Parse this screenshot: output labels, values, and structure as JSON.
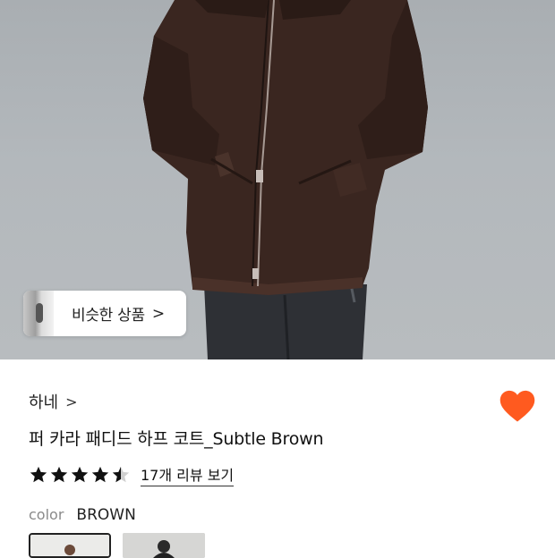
{
  "colors": {
    "accent": "#ff5a1f",
    "text": "#111111",
    "muted": "#8a8a8a"
  },
  "hero": {
    "image": "brown-padded-half-coat-photo",
    "similar_label": "비슷한 상품",
    "similar_chevron": ">"
  },
  "product": {
    "brand": "하네",
    "brand_chevron": ">",
    "title": "퍼 카라 패디드 하프 코트_Subtle Brown",
    "wishlisted": true,
    "rating": 4.5,
    "rating_max": 5,
    "reviews_link": "17개 리뷰 보기",
    "color_key": "color",
    "color_value": "BROWN",
    "swatches": [
      {
        "name": "brown",
        "selected": true
      },
      {
        "name": "dark-gray",
        "selected": false
      }
    ]
  }
}
